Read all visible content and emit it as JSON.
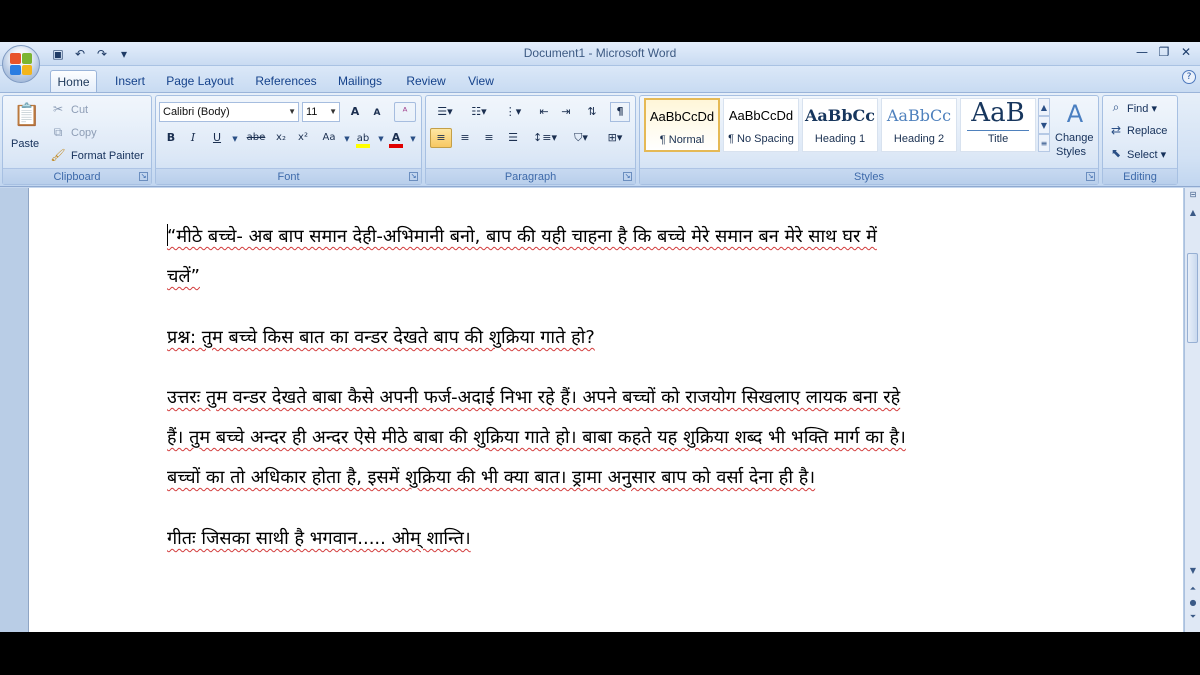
{
  "window": {
    "title": "Document1 - Microsoft Word"
  },
  "quick_access": {
    "icons": [
      "save-icon",
      "undo-icon",
      "redo-icon",
      "customize-icon"
    ]
  },
  "tabs": [
    {
      "label": "Home",
      "active": true
    },
    {
      "label": "Insert"
    },
    {
      "label": "Page Layout"
    },
    {
      "label": "References"
    },
    {
      "label": "Mailings"
    },
    {
      "label": "Review"
    },
    {
      "label": "View"
    }
  ],
  "clipboard": {
    "group_label": "Clipboard",
    "paste": "Paste",
    "cut": "Cut",
    "copy": "Copy",
    "format_painter": "Format Painter"
  },
  "font": {
    "group_label": "Font",
    "family": "Calibri (Body)",
    "size": "11",
    "bold": "B",
    "italic": "I",
    "underline": "U",
    "strike": "abe",
    "subscript": "x₂",
    "superscript": "x²",
    "change_case": "Aa",
    "grow": "A",
    "shrink": "A",
    "clear": "ᴬ"
  },
  "paragraph": {
    "group_label": "Paragraph",
    "show_marks": "¶"
  },
  "styles": {
    "group_label": "Styles",
    "items": [
      {
        "preview": "AaBbCcDd",
        "name": "¶ Normal",
        "selected": true
      },
      {
        "preview": "AaBbCcDd",
        "name": "¶ No Spacing"
      },
      {
        "preview": "AaBbCc",
        "name": "Heading 1"
      },
      {
        "preview": "AaBbCc",
        "name": "Heading 2"
      },
      {
        "preview": "AaB",
        "name": "Title"
      }
    ],
    "change_styles_line1": "Change",
    "change_styles_line2": "Styles"
  },
  "editing": {
    "group_label": "Editing",
    "find": "Find",
    "replace": "Replace",
    "select": "Select"
  },
  "document": {
    "p1_line1": "“मीठे बच्चे- अब बाप समान देही-अभिमानी बनो, बाप की यही चाहना है कि बच्चे मेरे समान बन मेरे साथ घर में",
    "p1_line2": "चलें”",
    "p2": "प्रश्न: तुम बच्चे किस बात का वन्डर देखते बाप की शुक्रिया गाते हो?",
    "p3_line1": "उत्तरः तुम वन्डर देखते बाबा कैसे अपनी फर्ज-अदाई निभा रहे हैं। अपने बच्चों को राजयोग सिखलाए लायक बना रहे",
    "p3_line2": "हैं। तुम बच्चे अन्दर ही अन्दर ऐसे मीठे बाबा की शुक्रिया गाते हो। बाबा कहते यह शुक्रिया शब्द भी भक्ति मार्ग का है।",
    "p3_line3": "बच्चों का तो अधिकार होता है, इसमें शुक्रिया की भी क्या बात। ड्रामा अनुसार बाप को वर्सा देना ही है।",
    "p4": "गीतः जिसका साथी है भगवान..... ओम् शान्ति।"
  },
  "colors": {
    "accent": "#15428b",
    "highlight": "#ffff00",
    "font_color": "#e00000"
  }
}
